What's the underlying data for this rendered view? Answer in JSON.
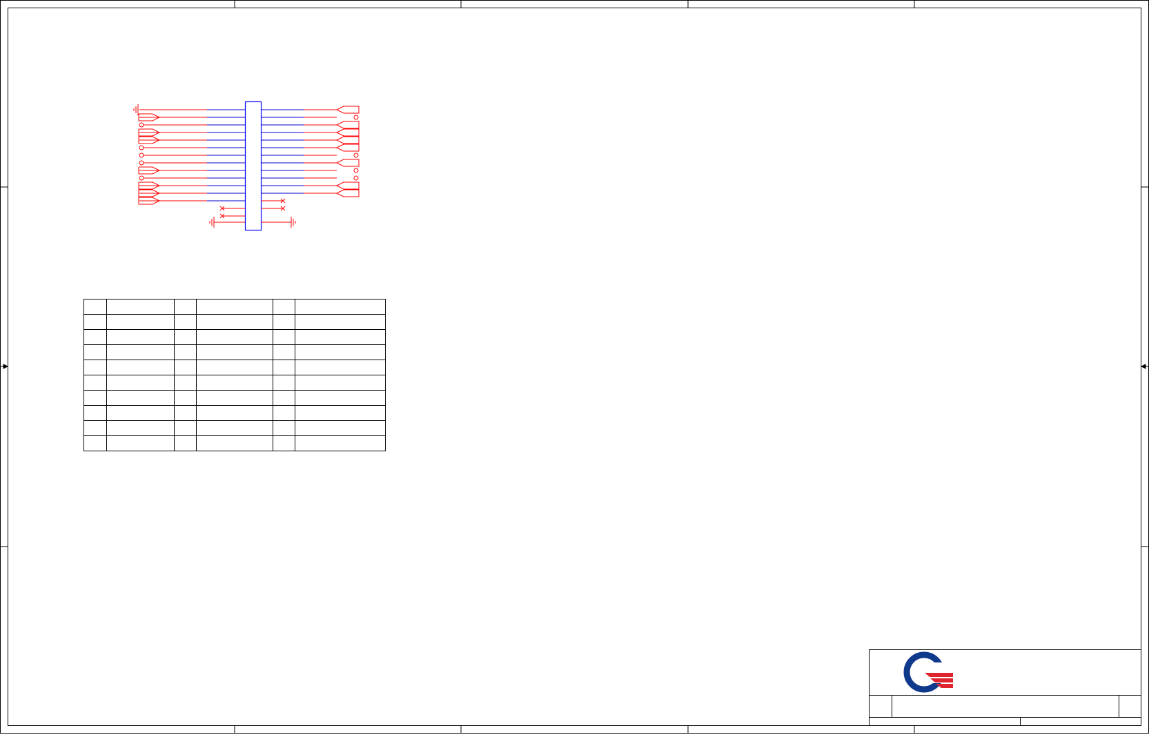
{
  "sheet": {
    "frame_color": "#000000",
    "background": "#ffffff",
    "ruler_markers": "arrow-marker-icon"
  },
  "schematic": {
    "wire_color": "#ff0000",
    "net_color": "#0000cc",
    "component_color": "#0000ff",
    "symbols": {
      "ground": "ground-icon",
      "offpage": "offpage-connector-icon",
      "test_point": "test-point-icon",
      "no_connect": "no-connect-icon"
    }
  },
  "pin_table": {
    "rows": 10,
    "columns": 6,
    "cells": []
  },
  "title_block": {
    "logo": "quanta-q-logo-icon",
    "logo_colors": {
      "ring": "#0f3a8c",
      "stripes": "#e0242e"
    }
  }
}
